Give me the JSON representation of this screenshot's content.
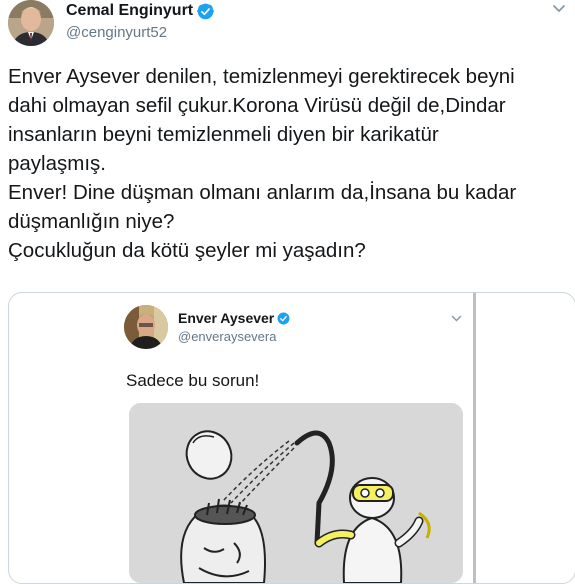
{
  "tweet": {
    "author_name": "Cemal Enginyurt",
    "handle": "@cenginyurt52",
    "text_lines": [
      "Enver Aysever denilen, temizlenmeyi gerektirecek beyni",
      "dahi olmayan sefil çukur.Korona Virüsü değil de,Dindar",
      "insanların beyni temizlenmeli diyen bir karikatür",
      "paylaşmış.",
      "Enver! Dine düşman olmanı anlarım da,İnsana bu kadar",
      "düşmanlığın niye?",
      "Çocukluğun da kötü şeyler mi yaşadın?"
    ]
  },
  "embedded_tweet": {
    "author_name": "Enver Aysever",
    "handle": "@enveraysevera",
    "text": "Sadece bu sorun!"
  },
  "colors": {
    "verified": "#1da1f2",
    "secondary_text": "#657786",
    "border": "#ccd6dd"
  },
  "icons": {
    "verified": "verified-badge-icon",
    "menu": "chevron-down-icon"
  }
}
